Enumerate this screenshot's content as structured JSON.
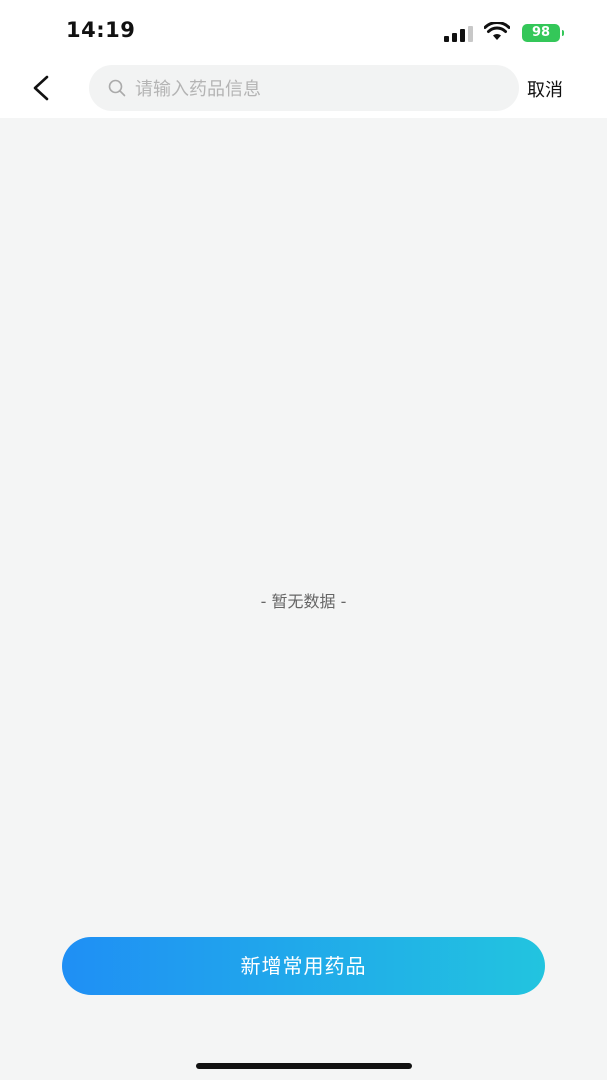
{
  "status_bar": {
    "time": "14:19",
    "battery": "98",
    "battery_color": "#34c759",
    "icons": [
      "signal-icon",
      "wifi-icon",
      "battery-icon"
    ]
  },
  "nav": {
    "back_icon": "chevron-left-icon",
    "search_icon": "search-icon",
    "search_placeholder": "请输入药品信息",
    "search_value": "",
    "cancel_label": "取消"
  },
  "empty_state": {
    "text": "- 暂无数据 -"
  },
  "actions": {
    "add_label": "新增常用药品",
    "gradient_start": "#1f8ff5",
    "gradient_end": "#22c4df"
  }
}
